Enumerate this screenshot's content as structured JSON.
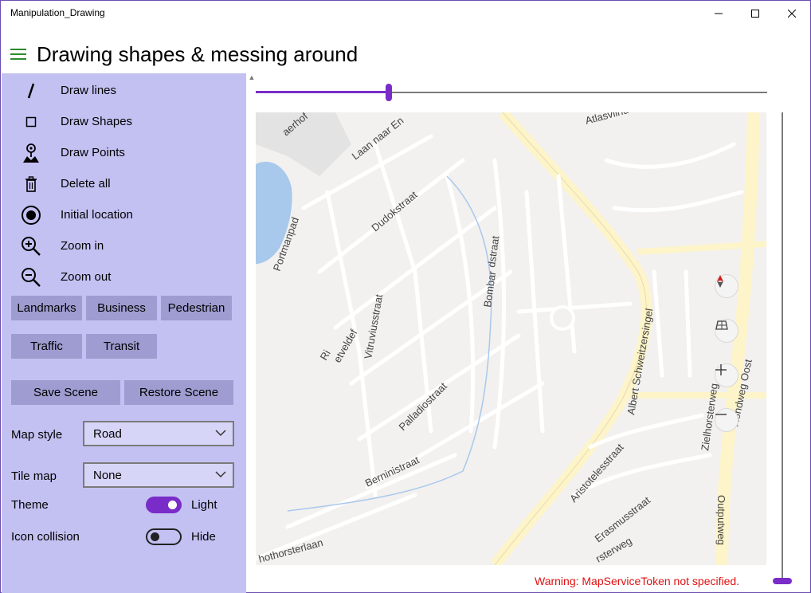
{
  "window": {
    "title": "Manipulation_Drawing"
  },
  "header": {
    "title": "Drawing shapes & messing around"
  },
  "menu": [
    {
      "label": "Draw lines",
      "icon": "slash-icon"
    },
    {
      "label": "Draw Shapes",
      "icon": "square-icon"
    },
    {
      "label": "Draw Points",
      "icon": "map-pin-icon"
    },
    {
      "label": "Delete all",
      "icon": "trash-icon"
    },
    {
      "label": "Initial location",
      "icon": "target-icon"
    },
    {
      "label": "Zoom in",
      "icon": "zoom-in-icon"
    },
    {
      "label": "Zoom out",
      "icon": "zoom-out-icon"
    }
  ],
  "layer_buttons": [
    "Landmarks",
    "Business",
    "Pedestrian",
    "Traffic",
    "Transit"
  ],
  "scene_buttons": {
    "save": "Save Scene",
    "restore": "Restore Scene"
  },
  "map_style": {
    "label": "Map style",
    "value": "Road"
  },
  "tile_map": {
    "label": "Tile map",
    "value": "None"
  },
  "theme": {
    "label": "Theme",
    "state": "Light",
    "on": true
  },
  "icon_collision": {
    "label": "Icon collision",
    "state": "Hide",
    "on": false
  },
  "sliders": {
    "horizontal_fraction": 0.26,
    "vertical_fraction": 0.0
  },
  "map": {
    "street_labels": [
      "Laan naar En",
      "Atlasvlinder",
      "Dudokstraat",
      "dstraat",
      "Bombar",
      "Portmanpad",
      "Vitruviusstraat",
      "Ri",
      "etveldef",
      "Palladiostraat",
      "Berninistraat",
      "Albert Schweitzersingel",
      "Zielhorsterweg",
      "Rondweg Oost",
      "Aristotelesstraat",
      "Erasmusstraat",
      "Outputweg",
      "rsterweg",
      "hothorsterlaan",
      "aerhof"
    ],
    "controls": [
      "compass-icon",
      "tilt-icon",
      "zoom-plus-icon",
      "zoom-minus-icon"
    ]
  },
  "warning": "Warning: MapServiceToken not specified.",
  "colors": {
    "sidebar": "#c3c1f2",
    "button": "#9e9cd0",
    "accent": "#7a2cc8",
    "warning": "#e01010",
    "map_bg": "#f2f1ef",
    "water": "#a8c8ec",
    "highway": "#fdf4c9"
  }
}
